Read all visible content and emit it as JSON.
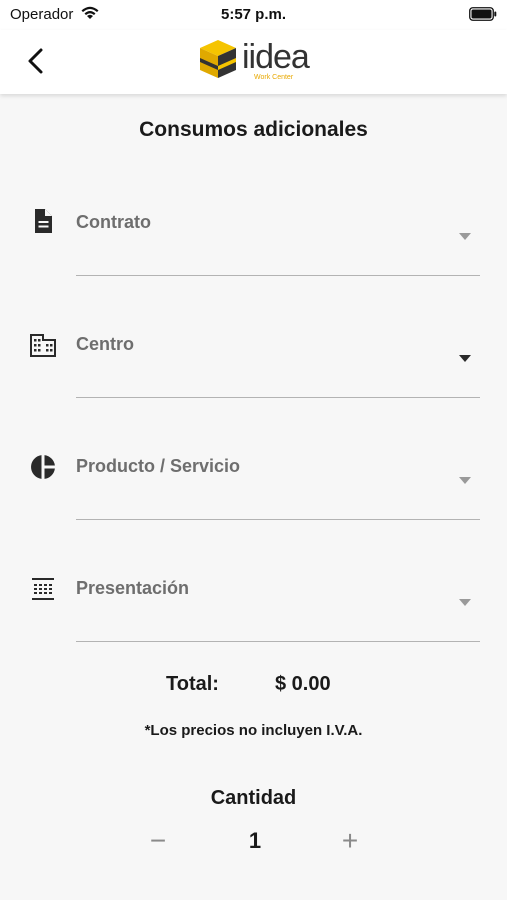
{
  "status_bar": {
    "carrier": "Operador",
    "time": "5:57 p.m.",
    "icons": [
      "wifi-icon",
      "battery-icon"
    ]
  },
  "nav": {
    "back_icon": "chevron-left-icon",
    "logo_text": "iidea",
    "logo_subtext": "Work Center",
    "logo_colors": {
      "cube": "#f5c400",
      "cube_dark": "#333333",
      "text": "#333333"
    }
  },
  "page": {
    "title": "Consumos adicionales"
  },
  "form": {
    "fields": [
      {
        "label": "Contrato",
        "icon": "document-icon"
      },
      {
        "label": "Centro",
        "icon": "building-icon"
      },
      {
        "label": "Producto / Servicio",
        "icon": "pie-chart-icon"
      },
      {
        "label": "Presentación",
        "icon": "grid-list-icon"
      }
    ]
  },
  "total": {
    "label": "Total:",
    "value": "$ 0.00"
  },
  "note": "*Los precios no incluyen I.V.A.",
  "quantity": {
    "title": "Cantidad",
    "minus": "−",
    "value": "1",
    "plus": "+"
  }
}
